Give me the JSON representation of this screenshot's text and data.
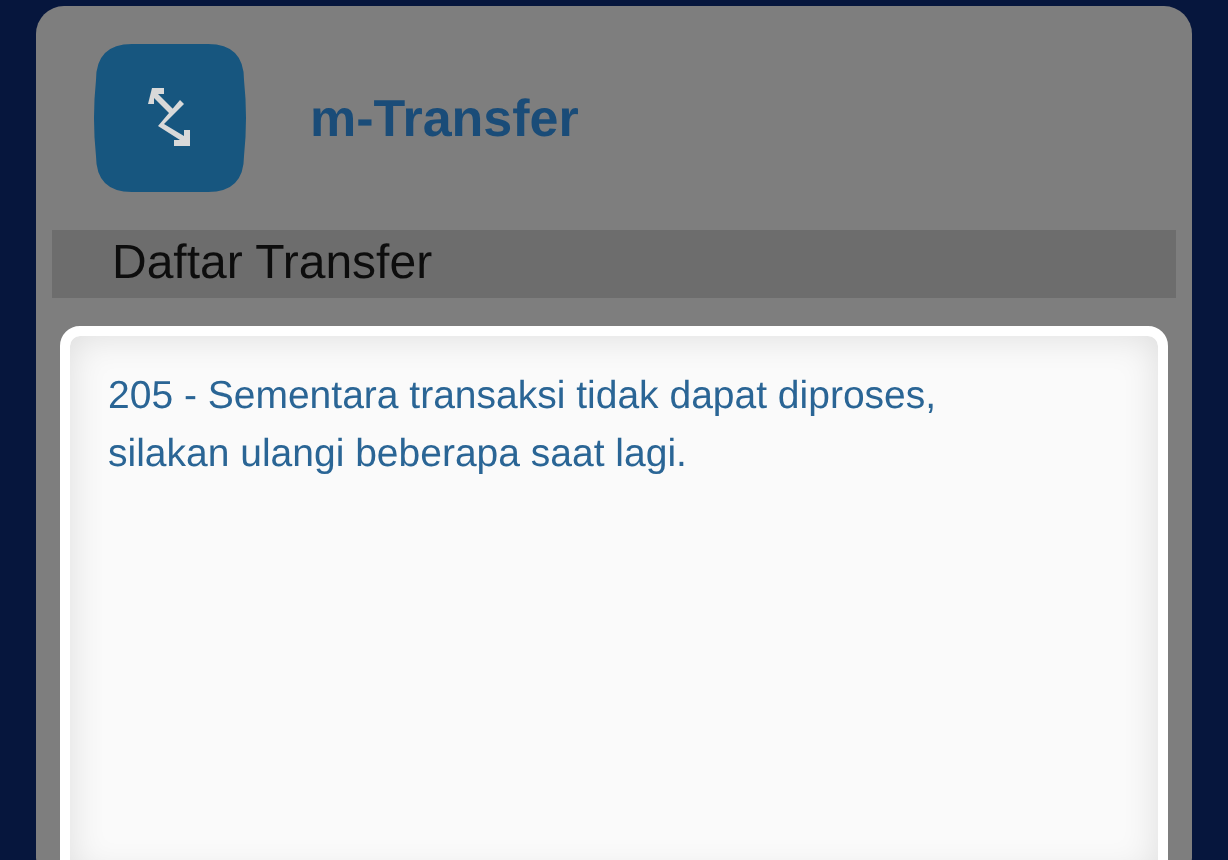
{
  "app": {
    "title": "m-Transfer"
  },
  "section": {
    "title": "Daftar Transfer"
  },
  "dialog": {
    "message": "205 - Sementara transaksi tidak dapat diproses, silakan ulangi beberapa saat lagi."
  }
}
